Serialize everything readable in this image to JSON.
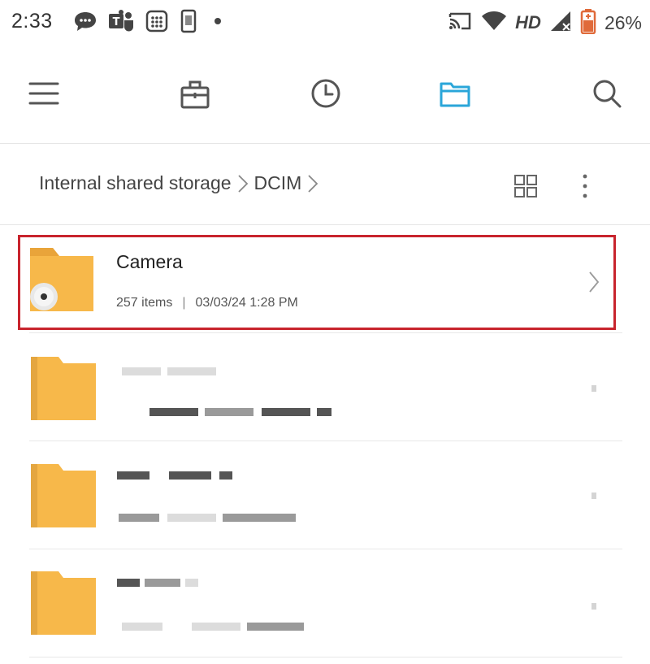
{
  "status_bar": {
    "time": "2:33",
    "network_label": "HD",
    "battery_percent": "26%",
    "icons": [
      "chat-icon",
      "teams-icon",
      "calculator-icon",
      "phone-icon",
      "dot-icon",
      "cast-icon",
      "wifi-icon",
      "signal-icon",
      "battery-icon"
    ]
  },
  "top_nav": {
    "items": [
      "menu-icon",
      "toolbox-icon",
      "recent-icon",
      "folder-icon",
      "search-icon"
    ],
    "active": "folder-icon",
    "accent_color": "#2aa6d9"
  },
  "breadcrumb": {
    "items": [
      "Internal shared storage",
      "DCIM"
    ]
  },
  "folders": [
    {
      "name": "Camera",
      "items": "257 items",
      "separator": "|",
      "modified": "03/03/24 1:28 PM",
      "highlighted": true
    }
  ],
  "colors": {
    "folder": "#f7b84a",
    "highlight_border": "#c8242d"
  }
}
